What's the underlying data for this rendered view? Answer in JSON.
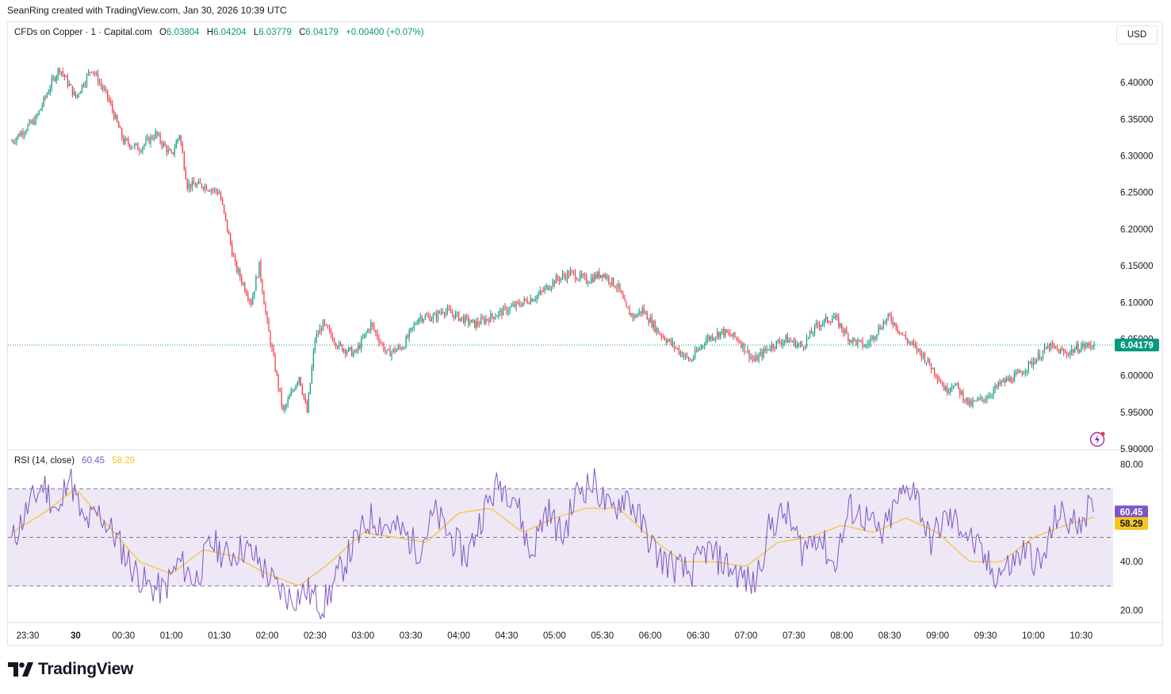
{
  "header": {
    "byline": "SeanRing created with TradingView.com, Jan 30, 2026 10:39 UTC"
  },
  "legend": {
    "symbol": "CFDs on Copper · 1 · Capital.com",
    "open_label": "O",
    "open": "6.03804",
    "high_label": "H",
    "high": "6.04204",
    "low_label": "L",
    "low": "6.03779",
    "close_label": "C",
    "close": "6.04179",
    "change": "+0.00400 (+0.07%)"
  },
  "currency_button": "USD",
  "rsi_legend": {
    "label": "RSI (14, close)",
    "rsi_value": "60.45",
    "ma_value": "58.29"
  },
  "brand": {
    "name": "TradingView",
    "logo_icon": "tradingview-logo-icon"
  },
  "colors": {
    "up": "#089981",
    "down": "#f23645",
    "rsi": "#7e57c2",
    "rsi_ma": "#f7c325",
    "rsi_band": "#ede7f6",
    "price_line": "#089981"
  },
  "chart_data": [
    {
      "type": "candlestick",
      "title": "CFDs on Copper · 1 · Capital.com",
      "ylim": [
        5.9,
        6.45
      ],
      "y_ticks": [
        "6.40000",
        "6.35000",
        "6.30000",
        "6.25000",
        "6.20000",
        "6.15000",
        "6.10000",
        "6.05000",
        "6.00000",
        "5.95000",
        "5.90000"
      ],
      "y_tick_values": [
        6.4,
        6.35,
        6.3,
        6.25,
        6.2,
        6.15,
        6.1,
        6.05,
        6.0,
        5.95,
        5.9
      ],
      "x_ticks": [
        "23:30",
        "30",
        "00:30",
        "01:00",
        "01:30",
        "02:00",
        "02:30",
        "03:00",
        "03:30",
        "04:00",
        "04:30",
        "05:00",
        "05:30",
        "06:00",
        "06:30",
        "07:00",
        "07:30",
        "08:00",
        "08:30",
        "09:00",
        "09:30",
        "10:00",
        "10:30"
      ],
      "last_price": 6.04179,
      "last_price_label": "6.04179",
      "close_path": {
        "times": [
          "23:20",
          "23:35",
          "23:45",
          "23:50",
          "00:00",
          "00:10",
          "00:20",
          "00:30",
          "00:40",
          "00:50",
          "01:00",
          "01:05",
          "01:10",
          "01:20",
          "01:30",
          "01:40",
          "01:50",
          "01:55",
          "02:00",
          "02:10",
          "02:20",
          "02:25",
          "02:30",
          "02:35",
          "02:45",
          "02:55",
          "03:05",
          "03:15",
          "03:25",
          "03:35",
          "03:45",
          "03:50",
          "04:00",
          "04:10",
          "04:20",
          "04:30",
          "04:40",
          "04:50",
          "05:00",
          "05:10",
          "05:20",
          "05:30",
          "05:40",
          "05:45",
          "05:50",
          "05:55",
          "06:05",
          "06:15",
          "06:25",
          "06:35",
          "06:45",
          "06:55",
          "07:05",
          "07:15",
          "07:25",
          "07:35",
          "07:45",
          "07:55",
          "08:05",
          "08:15",
          "08:25",
          "08:30",
          "08:40",
          "08:50",
          "09:00",
          "09:05",
          "09:10",
          "09:20",
          "09:30",
          "09:35",
          "09:40",
          "09:50",
          "10:00",
          "10:10",
          "10:20",
          "10:30",
          "10:38"
        ],
        "values": [
          6.32,
          6.35,
          6.4,
          6.42,
          6.38,
          6.42,
          6.38,
          6.32,
          6.31,
          6.33,
          6.3,
          6.33,
          6.26,
          6.26,
          6.25,
          6.15,
          6.1,
          6.15,
          6.07,
          5.95,
          6.0,
          5.95,
          6.05,
          6.07,
          6.04,
          6.03,
          6.07,
          6.03,
          6.04,
          6.08,
          6.08,
          6.09,
          6.08,
          6.07,
          6.08,
          6.09,
          6.1,
          6.11,
          6.13,
          6.14,
          6.13,
          6.14,
          6.12,
          6.09,
          6.08,
          6.09,
          6.06,
          6.04,
          6.02,
          6.05,
          6.06,
          6.05,
          6.02,
          6.04,
          6.05,
          6.04,
          6.07,
          6.08,
          6.05,
          6.04,
          6.07,
          6.08,
          6.05,
          6.03,
          6.0,
          5.98,
          5.99,
          5.96,
          5.97,
          5.98,
          5.99,
          6.0,
          6.02,
          6.04,
          6.03,
          6.04,
          6.04179
        ]
      }
    },
    {
      "type": "line",
      "title": "RSI (14, close)",
      "ylim": [
        15,
        85
      ],
      "y_ticks": [
        "80.00",
        "60.00",
        "40.00",
        "20.00"
      ],
      "y_tick_values": [
        80,
        60,
        40,
        20
      ],
      "bands": [
        70,
        50,
        30
      ],
      "series": [
        {
          "name": "RSI (14, close)",
          "last_label": "60.45",
          "times": [
            "23:20",
            "23:30",
            "23:40",
            "23:50",
            "23:55",
            "00:05",
            "00:15",
            "00:25",
            "00:35",
            "00:45",
            "00:55",
            "01:05",
            "01:15",
            "01:25",
            "01:35",
            "01:45",
            "01:55",
            "02:05",
            "02:15",
            "02:25",
            "02:35",
            "02:45",
            "02:55",
            "03:05",
            "03:15",
            "03:25",
            "03:35",
            "03:45",
            "03:55",
            "04:05",
            "04:15",
            "04:25",
            "04:35",
            "04:45",
            "04:55",
            "05:05",
            "05:15",
            "05:25",
            "05:35",
            "05:45",
            "05:55",
            "06:05",
            "06:15",
            "06:25",
            "06:35",
            "06:45",
            "06:55",
            "07:05",
            "07:15",
            "07:25",
            "07:35",
            "07:45",
            "07:55",
            "08:05",
            "08:15",
            "08:25",
            "08:35",
            "08:45",
            "08:55",
            "09:05",
            "09:15",
            "09:25",
            "09:35",
            "09:45",
            "09:55",
            "10:05",
            "10:15",
            "10:25",
            "10:35",
            "10:38"
          ],
          "values": [
            48,
            62,
            72,
            58,
            78,
            55,
            60,
            50,
            38,
            30,
            28,
            40,
            32,
            48,
            42,
            46,
            40,
            30,
            25,
            28,
            22,
            35,
            48,
            58,
            55,
            52,
            45,
            60,
            50,
            42,
            60,
            72,
            68,
            42,
            62,
            50,
            70,
            72,
            60,
            68,
            55,
            42,
            38,
            35,
            45,
            40,
            35,
            30,
            55,
            60,
            45,
            52,
            38,
            62,
            58,
            50,
            65,
            72,
            48,
            58,
            55,
            45,
            35,
            38,
            45,
            38,
            60,
            55,
            62,
            60.45
          ]
        },
        {
          "name": "",
          "last_label": "58.29",
          "times": [
            "23:20",
            "23:40",
            "00:00",
            "00:20",
            "00:40",
            "01:00",
            "01:20",
            "01:40",
            "02:00",
            "02:20",
            "02:40",
            "03:00",
            "03:20",
            "03:40",
            "04:00",
            "04:20",
            "04:40",
            "05:00",
            "05:20",
            "05:40",
            "06:00",
            "06:20",
            "06:40",
            "07:00",
            "07:20",
            "07:40",
            "08:00",
            "08:20",
            "08:40",
            "09:00",
            "09:20",
            "09:40",
            "10:00",
            "10:20",
            "10:38"
          ],
          "values": [
            52,
            60,
            70,
            55,
            40,
            35,
            45,
            42,
            35,
            30,
            40,
            52,
            50,
            48,
            60,
            62,
            52,
            58,
            62,
            62,
            50,
            40,
            40,
            38,
            48,
            50,
            55,
            52,
            58,
            52,
            40,
            40,
            50,
            55,
            58.29
          ]
        }
      ]
    }
  ]
}
